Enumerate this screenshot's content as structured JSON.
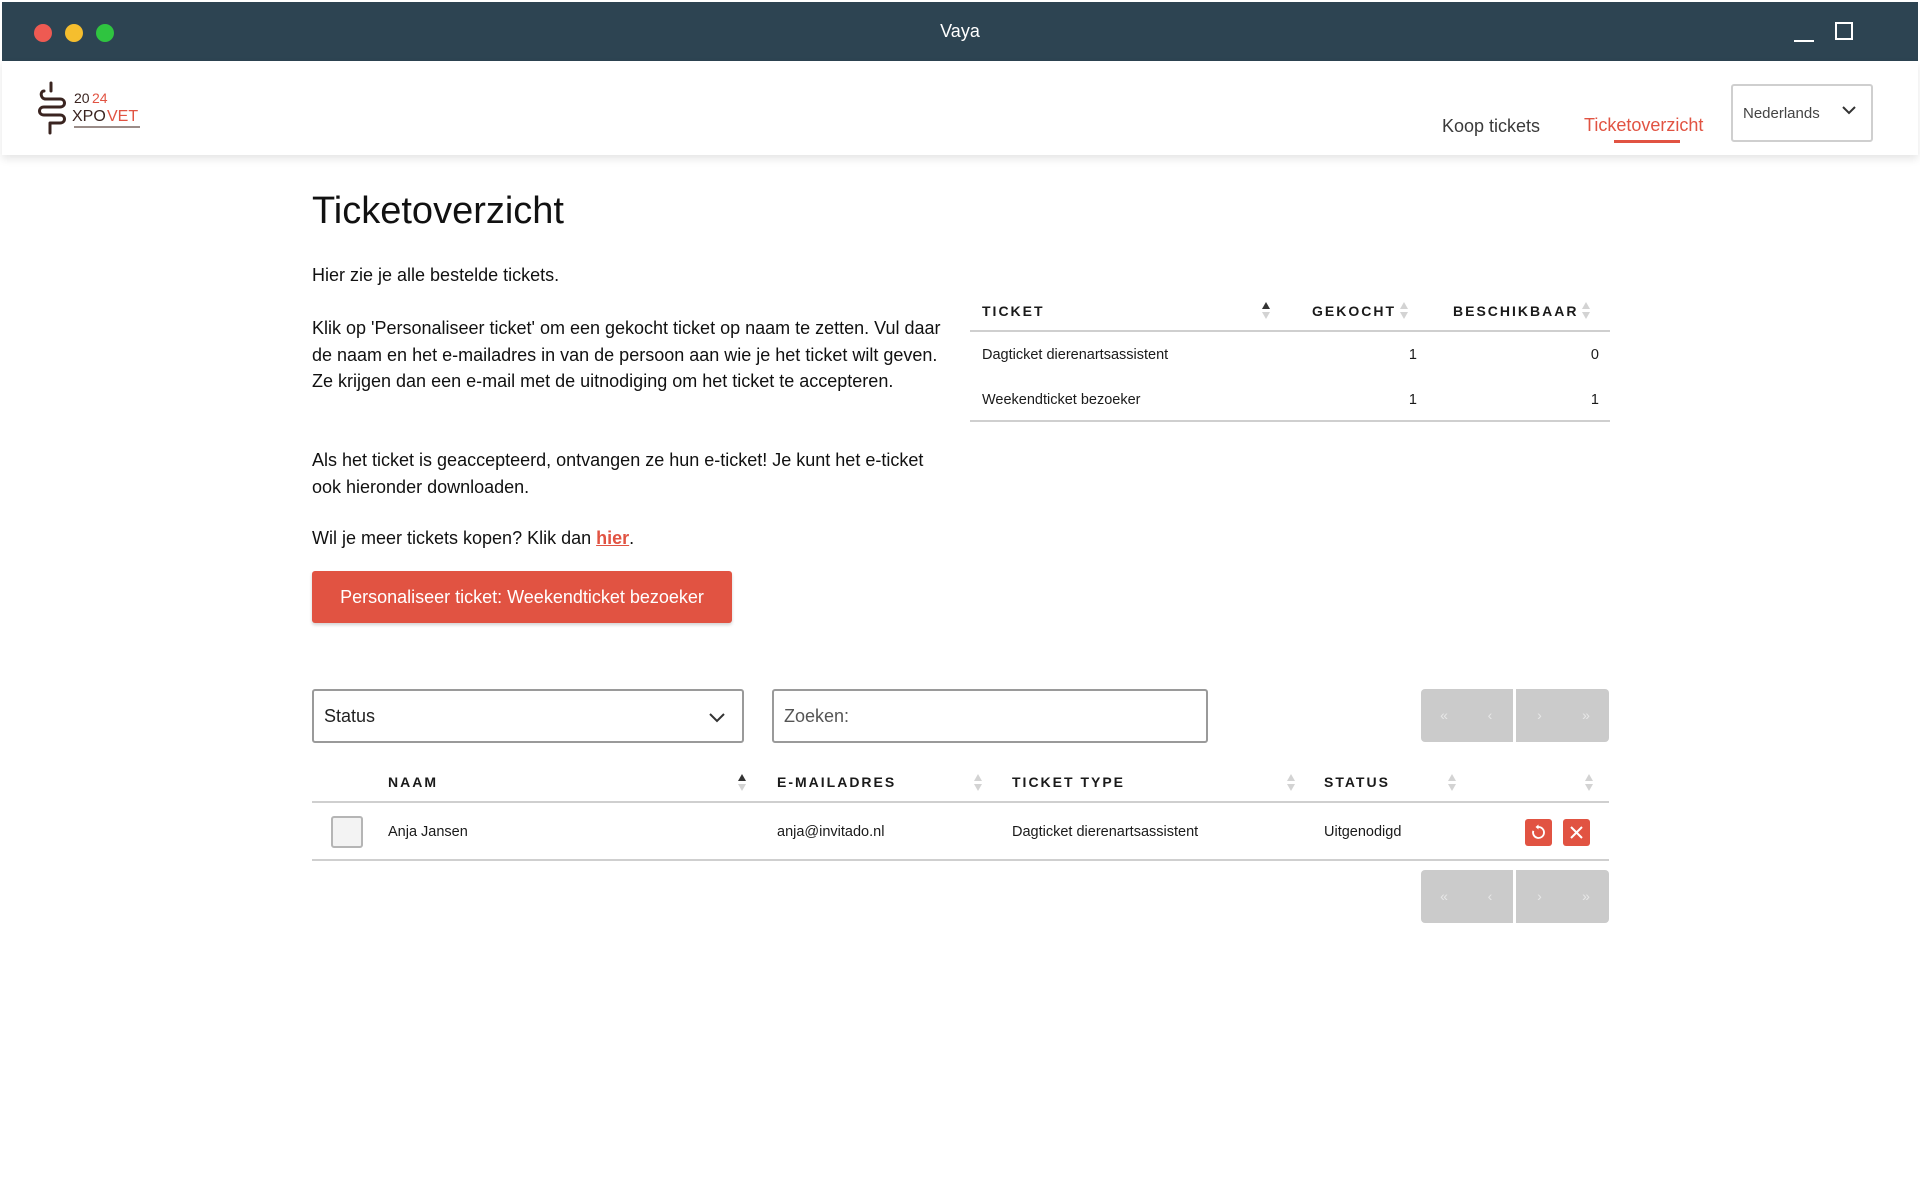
{
  "window": {
    "title": "Vaya"
  },
  "header": {
    "logo_year": "2024",
    "logo_brand_a": "XPO",
    "logo_brand_b": "VET",
    "nav": [
      {
        "label": "Koop tickets",
        "active": false
      },
      {
        "label": "Ticketoverzicht",
        "active": true
      }
    ],
    "language": "Nederlands"
  },
  "page": {
    "title": "Ticketoverzicht",
    "intro": "Hier zie je alle bestelde tickets.",
    "personalise_text": "Klik op 'Personaliseer ticket' om een gekocht ticket op naam te zetten. Vul daar de naam en het e-mailadres in van de persoon aan wie je het ticket wilt geven. Ze krijgen dan een e-mail met de uitnodiging om het ticket te accepteren.",
    "accepted_text": "Als het ticket is geaccepteerd, ontvangen ze hun e-ticket! Je kunt het e-ticket ook hieronder downloaden.",
    "more_prefix": "Wil je meer tickets kopen? Klik dan ",
    "more_link": "hier",
    "more_suffix": ".",
    "personalise_button": "Personaliseer ticket: Weekendticket bezoeker"
  },
  "summary_table": {
    "columns": [
      "TICKET",
      "GEKOCHT",
      "BESCHIKBAAR"
    ],
    "rows": [
      {
        "ticket": "Dagticket dierenartsassistent",
        "gekocht": "1",
        "beschikbaar": "0"
      },
      {
        "ticket": "Weekendticket bezoeker",
        "gekocht": "1",
        "beschikbaar": "1"
      }
    ]
  },
  "filters": {
    "status_label": "Status",
    "search_placeholder": "Zoeken:"
  },
  "pagination": {
    "first": "«",
    "prev": "‹",
    "next": "›",
    "last": "»"
  },
  "attendees_table": {
    "columns": [
      "NAAM",
      "E-MAILADRES",
      "TICKET TYPE",
      "STATUS"
    ],
    "rows": [
      {
        "naam": "Anja Jansen",
        "email": "anja@invitado.nl",
        "ticket_type": "Dagticket dierenartsassistent",
        "status": "Uitgenodigd"
      }
    ]
  },
  "colors": {
    "titlebar": "#2d4452",
    "accent": "#e15342",
    "pager_disabled": "#cbcbcb"
  },
  "icons": [
    "chevron-down-icon",
    "sort-icon",
    "reset-icon",
    "close-icon",
    "logo-icon"
  ]
}
